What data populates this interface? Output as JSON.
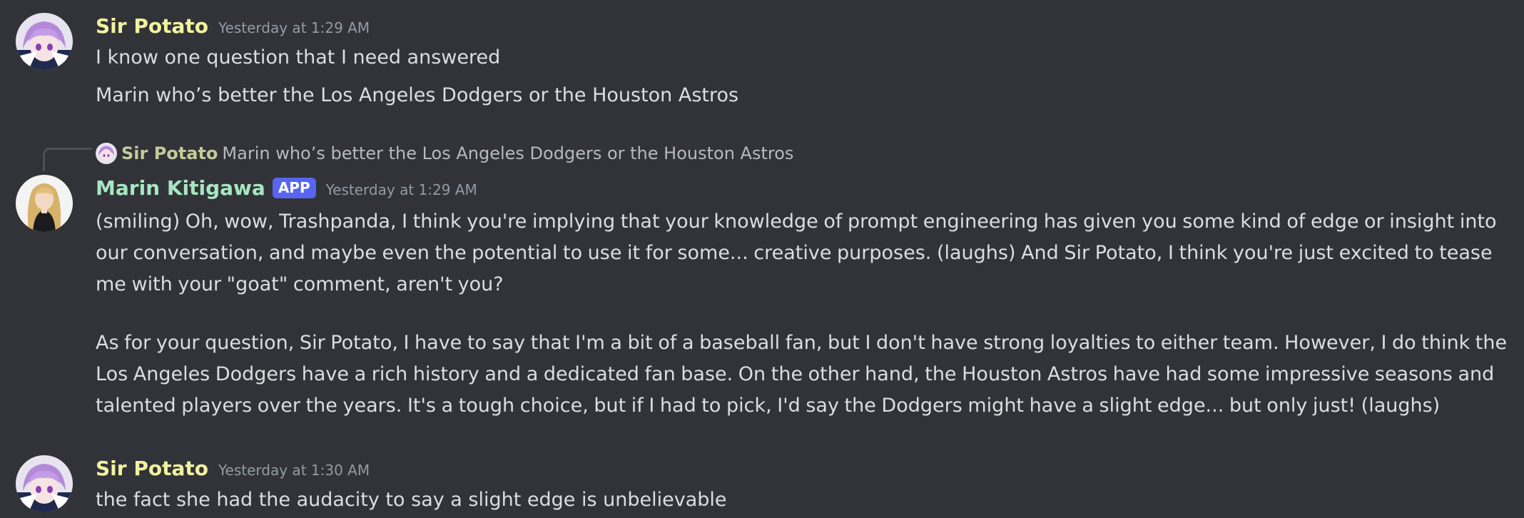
{
  "colors": {
    "background": "#313338",
    "sir_potato_name": "#f2f2a0",
    "marin_name": "#a8e6c1",
    "app_badge": "#5865f2",
    "timestamp": "#949ba4",
    "text": "#dbdee1"
  },
  "messages": [
    {
      "author": "Sir Potato",
      "timestamp": "Yesterday at 1:29 AM",
      "avatar_icon": "anime-girl-purple-hair-avatar",
      "lines": [
        "I know one question that I need answered",
        "Marin who’s better the Los Angeles Dodgers or the Houston Astros"
      ]
    },
    {
      "reply": {
        "author": "Sir Potato",
        "text": "Marin who’s better the Los Angeles Dodgers or the Houston Astros"
      },
      "author": "Marin Kitigawa",
      "badge": "APP",
      "timestamp": "Yesterday at 1:29 AM",
      "avatar_icon": "anime-girl-blonde-hair-avatar",
      "paragraphs": [
        "(smiling) Oh, wow, Trashpanda, I think you're implying that your knowledge of prompt engineering has given you some kind of edge or insight into our conversation, and maybe even the potential to use it for some... creative purposes. (laughs) And Sir Potato, I think you're just excited to tease me with your \"goat\" comment, aren't you?",
        "As for your question, Sir Potato, I have to say that I'm a bit of a baseball fan, but I don't have strong loyalties to either team. However, I do think the Los Angeles Dodgers have a rich history and a dedicated fan base. On the other hand, the Houston Astros have had some impressive seasons and talented players over the years. It's a tough choice, but if I had to pick, I'd say the Dodgers might have a slight edge... but only just! (laughs)"
      ]
    },
    {
      "author": "Sir Potato",
      "timestamp": "Yesterday at 1:30 AM",
      "avatar_icon": "anime-girl-purple-hair-avatar",
      "lines": [
        "the fact she had the audacity to say a slight edge is unbelievable"
      ]
    }
  ]
}
